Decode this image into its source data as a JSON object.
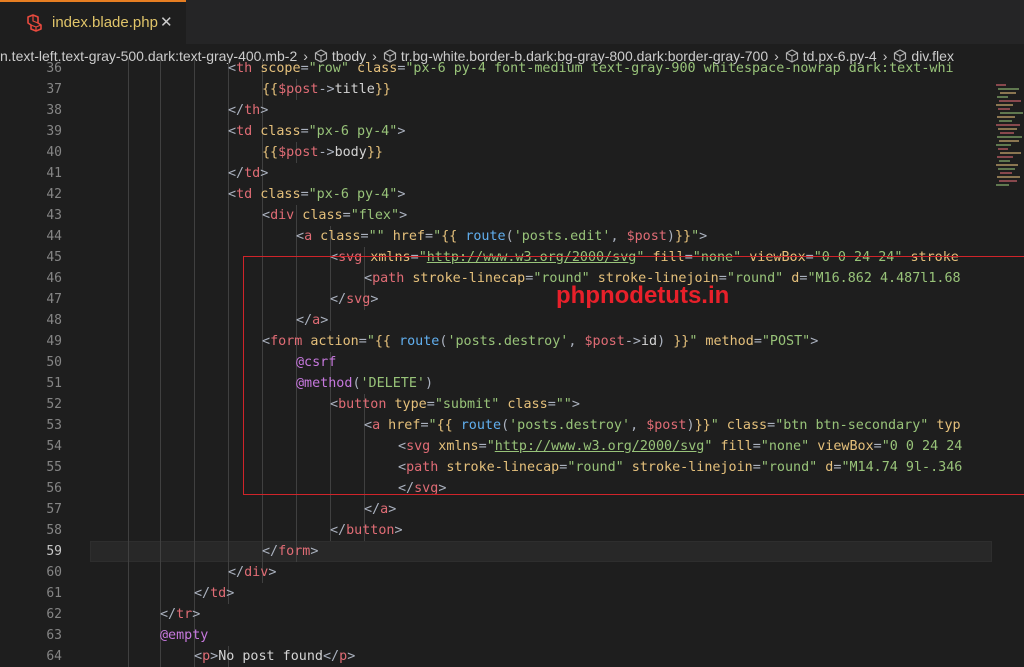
{
  "tab": {
    "icon": "laravel-icon",
    "filename": "index.blade.php",
    "close": "✕"
  },
  "breadcrumb": [
    {
      "label": "n.text-left.text-gray-500.dark:text-gray-400.mb-2",
      "icon": ""
    },
    {
      "label": "tbody",
      "icon": "element-icon"
    },
    {
      "label": "tr.bg-white.border-b.dark:bg-gray-800.dark:border-gray-700",
      "icon": "element-icon"
    },
    {
      "label": "td.px-6.py-4",
      "icon": "element-icon"
    },
    {
      "label": "div.flex",
      "icon": "element-icon"
    }
  ],
  "editor": {
    "active_line": 59,
    "lines": [
      {
        "n": "36",
        "tokens": [
          [
            "t-pun",
            "<"
          ],
          [
            "t-tag",
            "th"
          ],
          [
            "t-attr",
            " scope"
          ],
          [
            "t-pun",
            "="
          ],
          [
            "t-str",
            "\"row\""
          ],
          [
            "t-attr",
            " class"
          ],
          [
            "t-pun",
            "="
          ],
          [
            "t-str",
            "\"px-6 py-4 font-medium text-gray-900 whitespace-nowrap dark:text-whi"
          ]
        ]
      },
      {
        "n": "37",
        "tokens": [
          [
            "t-br",
            "{{"
          ],
          [
            "t-var",
            "$post"
          ],
          [
            "t-pun",
            "->"
          ],
          [
            "t-txt",
            "title"
          ],
          [
            "t-br",
            "}}"
          ]
        ]
      },
      {
        "n": "38",
        "tokens": [
          [
            "t-pun",
            "</"
          ],
          [
            "t-tag",
            "th"
          ],
          [
            "t-pun",
            ">"
          ]
        ]
      },
      {
        "n": "39",
        "tokens": [
          [
            "t-pun",
            "<"
          ],
          [
            "t-tag",
            "td"
          ],
          [
            "t-attr",
            " class"
          ],
          [
            "t-pun",
            "="
          ],
          [
            "t-str",
            "\"px-6 py-4\""
          ],
          [
            "t-pun",
            ">"
          ]
        ]
      },
      {
        "n": "40",
        "tokens": [
          [
            "t-br",
            "{{"
          ],
          [
            "t-var",
            "$post"
          ],
          [
            "t-pun",
            "->"
          ],
          [
            "t-txt",
            "body"
          ],
          [
            "t-br",
            "}}"
          ]
        ]
      },
      {
        "n": "41",
        "tokens": [
          [
            "t-pun",
            "</"
          ],
          [
            "t-tag",
            "td"
          ],
          [
            "t-pun",
            ">"
          ]
        ]
      },
      {
        "n": "42",
        "tokens": [
          [
            "t-pun",
            "<"
          ],
          [
            "t-tag",
            "td"
          ],
          [
            "t-attr",
            " class"
          ],
          [
            "t-pun",
            "="
          ],
          [
            "t-str",
            "\"px-6 py-4\""
          ],
          [
            "t-pun",
            ">"
          ]
        ]
      },
      {
        "n": "43",
        "tokens": [
          [
            "t-pun",
            "<"
          ],
          [
            "t-tag",
            "div"
          ],
          [
            "t-attr",
            " class"
          ],
          [
            "t-pun",
            "="
          ],
          [
            "t-str",
            "\"flex\""
          ],
          [
            "t-pun",
            ">"
          ]
        ]
      },
      {
        "n": "44",
        "tokens": [
          [
            "t-pun",
            "<"
          ],
          [
            "t-tag",
            "a"
          ],
          [
            "t-attr",
            " class"
          ],
          [
            "t-pun",
            "="
          ],
          [
            "t-str",
            "\"\""
          ],
          [
            "t-attr",
            " href"
          ],
          [
            "t-pun",
            "="
          ],
          [
            "t-str",
            "\""
          ],
          [
            "t-br",
            "{{ "
          ],
          [
            "t-fn",
            "route"
          ],
          [
            "t-pun",
            "("
          ],
          [
            "t-str",
            "'posts.edit'"
          ],
          [
            "t-pun",
            ", "
          ],
          [
            "t-var",
            "$post"
          ],
          [
            "t-pun",
            ")"
          ],
          [
            "t-br",
            "}}"
          ],
          [
            "t-str",
            "\""
          ],
          [
            "t-pun",
            ">"
          ]
        ]
      },
      {
        "n": "45",
        "tokens": [
          [
            "t-pun",
            "<"
          ],
          [
            "t-tag",
            "svg"
          ],
          [
            "t-attr",
            " xmlns"
          ],
          [
            "t-pun",
            "="
          ],
          [
            "t-str",
            "\""
          ],
          [
            "t-url",
            "http://www.w3.org/2000/svg"
          ],
          [
            "t-str",
            "\""
          ],
          [
            "t-attr",
            " fill"
          ],
          [
            "t-pun",
            "="
          ],
          [
            "t-str",
            "\"none\""
          ],
          [
            "t-attr",
            " viewBox"
          ],
          [
            "t-pun",
            "="
          ],
          [
            "t-str",
            "\"0 0 24 24\""
          ],
          [
            "t-attr",
            " stroke"
          ]
        ]
      },
      {
        "n": "46",
        "tokens": [
          [
            "t-pun",
            "<"
          ],
          [
            "t-tag",
            "path"
          ],
          [
            "t-attr",
            " stroke-linecap"
          ],
          [
            "t-pun",
            "="
          ],
          [
            "t-str",
            "\"round\""
          ],
          [
            "t-attr",
            " stroke-linejoin"
          ],
          [
            "t-pun",
            "="
          ],
          [
            "t-str",
            "\"round\""
          ],
          [
            "t-attr",
            " d"
          ],
          [
            "t-pun",
            "="
          ],
          [
            "t-str",
            "\"M16.862 4.487l1.68"
          ]
        ]
      },
      {
        "n": "47",
        "tokens": [
          [
            "t-pun",
            "</"
          ],
          [
            "t-tag",
            "svg"
          ],
          [
            "t-pun",
            ">"
          ]
        ]
      },
      {
        "n": "48",
        "tokens": [
          [
            "t-pun",
            "</"
          ],
          [
            "t-tag",
            "a"
          ],
          [
            "t-pun",
            ">"
          ]
        ]
      },
      {
        "n": "49",
        "tokens": [
          [
            "t-pun",
            "<"
          ],
          [
            "t-tag",
            "form"
          ],
          [
            "t-attr",
            " action"
          ],
          [
            "t-pun",
            "="
          ],
          [
            "t-str",
            "\""
          ],
          [
            "t-br",
            "{{ "
          ],
          [
            "t-fn",
            "route"
          ],
          [
            "t-pun",
            "("
          ],
          [
            "t-str",
            "'posts.destroy'"
          ],
          [
            "t-pun",
            ", "
          ],
          [
            "t-var",
            "$post"
          ],
          [
            "t-pun",
            "->"
          ],
          [
            "t-txt",
            "id"
          ],
          [
            "t-pun",
            ") "
          ],
          [
            "t-br",
            "}}"
          ],
          [
            "t-str",
            "\""
          ],
          [
            "t-attr",
            " method"
          ],
          [
            "t-pun",
            "="
          ],
          [
            "t-str",
            "\"POST\""
          ],
          [
            "t-pun",
            ">"
          ]
        ]
      },
      {
        "n": "50",
        "tokens": [
          [
            "t-dir",
            "@csrf"
          ]
        ]
      },
      {
        "n": "51",
        "tokens": [
          [
            "t-dir",
            "@method"
          ],
          [
            "t-pun",
            "("
          ],
          [
            "t-str",
            "'DELETE'"
          ],
          [
            "t-pun",
            ")"
          ]
        ]
      },
      {
        "n": "52",
        "tokens": [
          [
            "t-pun",
            "<"
          ],
          [
            "t-tag",
            "button"
          ],
          [
            "t-attr",
            " type"
          ],
          [
            "t-pun",
            "="
          ],
          [
            "t-str",
            "\"submit\""
          ],
          [
            "t-attr",
            " class"
          ],
          [
            "t-pun",
            "="
          ],
          [
            "t-str",
            "\"\""
          ],
          [
            "t-pun",
            ">"
          ]
        ]
      },
      {
        "n": "53",
        "tokens": [
          [
            "t-pun",
            "<"
          ],
          [
            "t-tag",
            "a"
          ],
          [
            "t-attr",
            " href"
          ],
          [
            "t-pun",
            "="
          ],
          [
            "t-str",
            "\""
          ],
          [
            "t-br",
            "{{ "
          ],
          [
            "t-fn",
            "route"
          ],
          [
            "t-pun",
            "("
          ],
          [
            "t-str",
            "'posts.destroy'"
          ],
          [
            "t-pun",
            ", "
          ],
          [
            "t-var",
            "$post"
          ],
          [
            "t-pun",
            ")"
          ],
          [
            "t-br",
            "}}"
          ],
          [
            "t-str",
            "\""
          ],
          [
            "t-attr",
            " class"
          ],
          [
            "t-pun",
            "="
          ],
          [
            "t-str",
            "\"btn btn-secondary\""
          ],
          [
            "t-attr",
            " typ"
          ]
        ]
      },
      {
        "n": "54",
        "tokens": [
          [
            "t-pun",
            "<"
          ],
          [
            "t-tag",
            "svg"
          ],
          [
            "t-attr",
            " xmlns"
          ],
          [
            "t-pun",
            "="
          ],
          [
            "t-str",
            "\""
          ],
          [
            "t-url",
            "http://www.w3.org/2000/svg"
          ],
          [
            "t-str",
            "\""
          ],
          [
            "t-attr",
            " fill"
          ],
          [
            "t-pun",
            "="
          ],
          [
            "t-str",
            "\"none\""
          ],
          [
            "t-attr",
            " viewBox"
          ],
          [
            "t-pun",
            "="
          ],
          [
            "t-str",
            "\"0 0 24 24"
          ]
        ]
      },
      {
        "n": "55",
        "tokens": [
          [
            "t-pun",
            "<"
          ],
          [
            "t-tag",
            "path"
          ],
          [
            "t-attr",
            " stroke-linecap"
          ],
          [
            "t-pun",
            "="
          ],
          [
            "t-str",
            "\"round\""
          ],
          [
            "t-attr",
            " stroke-linejoin"
          ],
          [
            "t-pun",
            "="
          ],
          [
            "t-str",
            "\"round\""
          ],
          [
            "t-attr",
            " d"
          ],
          [
            "t-pun",
            "="
          ],
          [
            "t-str",
            "\"M14.74 9l-.346"
          ]
        ]
      },
      {
        "n": "56",
        "tokens": [
          [
            "t-pun",
            "</"
          ],
          [
            "t-tag",
            "svg"
          ],
          [
            "t-pun",
            ">"
          ]
        ]
      },
      {
        "n": "57",
        "tokens": [
          [
            "t-pun",
            "</"
          ],
          [
            "t-tag",
            "a"
          ],
          [
            "t-pun",
            ">"
          ]
        ]
      },
      {
        "n": "58",
        "tokens": [
          [
            "t-pun",
            "</"
          ],
          [
            "t-tag",
            "button"
          ],
          [
            "t-pun",
            ">"
          ]
        ]
      },
      {
        "n": "59",
        "tokens": [
          [
            "t-pun",
            "</"
          ],
          [
            "t-tag",
            "form"
          ],
          [
            "t-pun",
            ">"
          ]
        ]
      },
      {
        "n": "60",
        "tokens": [
          [
            "t-pun",
            "</"
          ],
          [
            "t-tag",
            "div"
          ],
          [
            "t-pun",
            ">"
          ]
        ]
      },
      {
        "n": "61",
        "tokens": [
          [
            "t-pun",
            "</"
          ],
          [
            "t-tag",
            "td"
          ],
          [
            "t-pun",
            ">"
          ]
        ]
      },
      {
        "n": "62",
        "tokens": [
          [
            "t-pun",
            "</"
          ],
          [
            "t-tag",
            "tr"
          ],
          [
            "t-pun",
            ">"
          ]
        ]
      },
      {
        "n": "63",
        "tokens": [
          [
            "t-dir",
            "@empty"
          ]
        ]
      },
      {
        "n": "64",
        "tokens": [
          [
            "t-pun",
            "<"
          ],
          [
            "t-tag",
            "p"
          ],
          [
            "t-pun",
            ">"
          ],
          [
            "t-txt",
            "No post found"
          ],
          [
            "t-pun",
            "</"
          ],
          [
            "t-tag",
            "p"
          ],
          [
            "t-pun",
            ">"
          ]
        ]
      }
    ]
  },
  "watermark": "phpnodetuts.in",
  "colors": {
    "highlight_box": "#d0242a",
    "watermark": "#e8202a",
    "accent_tab": "#e67e22"
  }
}
